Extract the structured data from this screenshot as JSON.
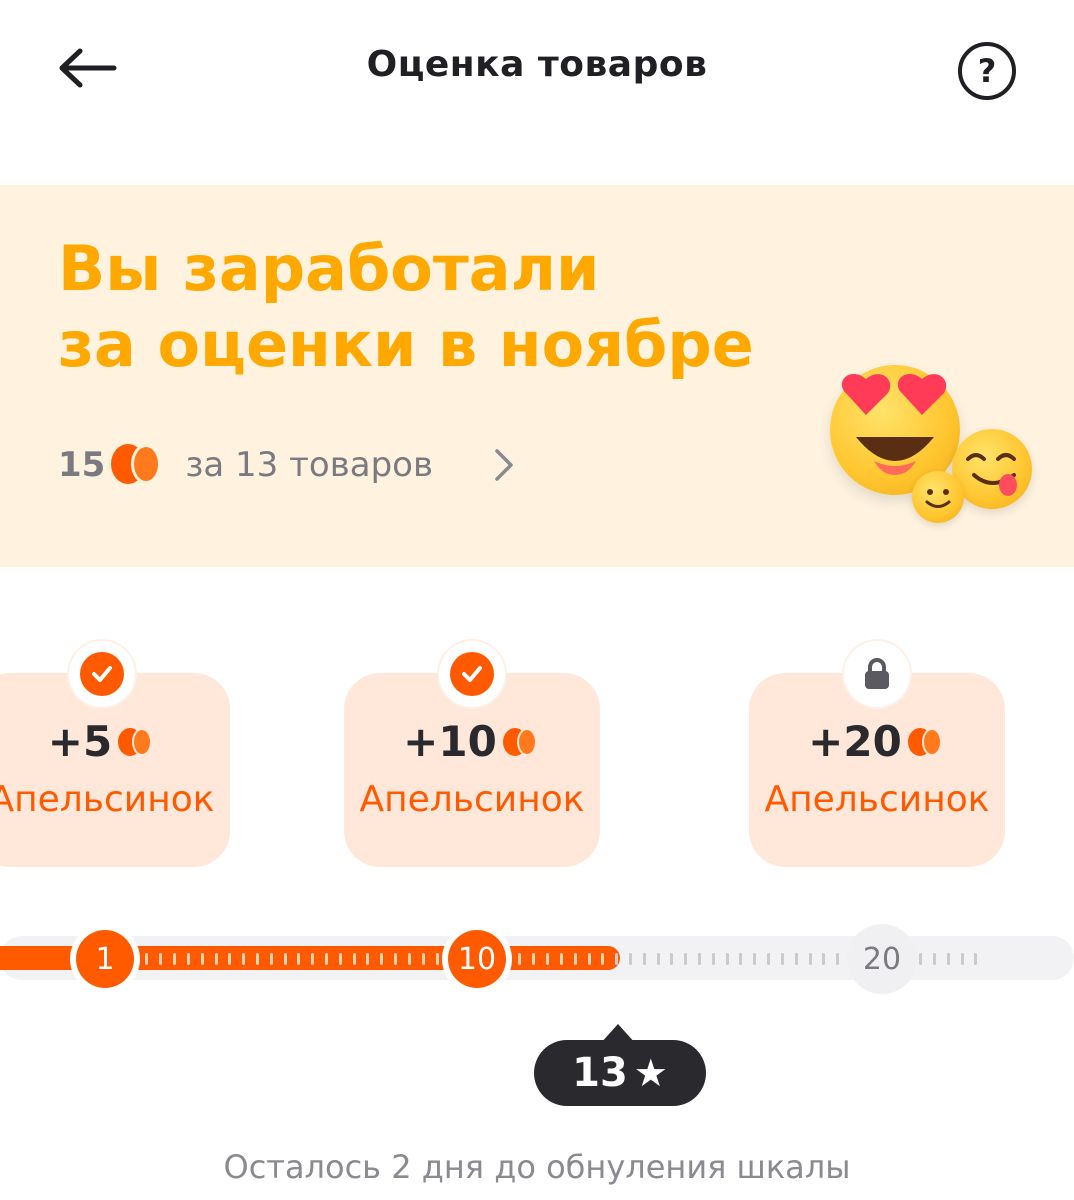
{
  "header": {
    "title": "Оценка товаров",
    "help_label": "?"
  },
  "banner": {
    "title_line1": "Вы заработали",
    "title_line2": "за оценки в ноябре",
    "earned_amount": "15",
    "earned_text": "за 13 товаров"
  },
  "rewards": [
    {
      "points": "+5",
      "label": "Апельсинок",
      "status": "done"
    },
    {
      "points": "+10",
      "label": "Апельсинок",
      "status": "done"
    },
    {
      "points": "+20",
      "label": "Апельсинок",
      "status": "locked"
    }
  ],
  "scale": {
    "milestones": [
      "1",
      "10",
      "20"
    ],
    "current": "13",
    "current_icon": "★",
    "progress_value": 13
  },
  "footer": {
    "reset_text": "Осталось 2 дня до обнуления шкалы"
  },
  "colors": {
    "accent": "#ff5a00",
    "banner_bg": "#fff3e0",
    "banner_title": "#ffa800",
    "card_bg": "#ffe8da"
  },
  "icons": {
    "back": "arrow-left-icon",
    "help": "question-circle-icon",
    "coin": "orange-coin-icon",
    "chevron": "chevron-right-icon",
    "check": "check-icon",
    "lock": "lock-icon",
    "star": "star-icon"
  }
}
